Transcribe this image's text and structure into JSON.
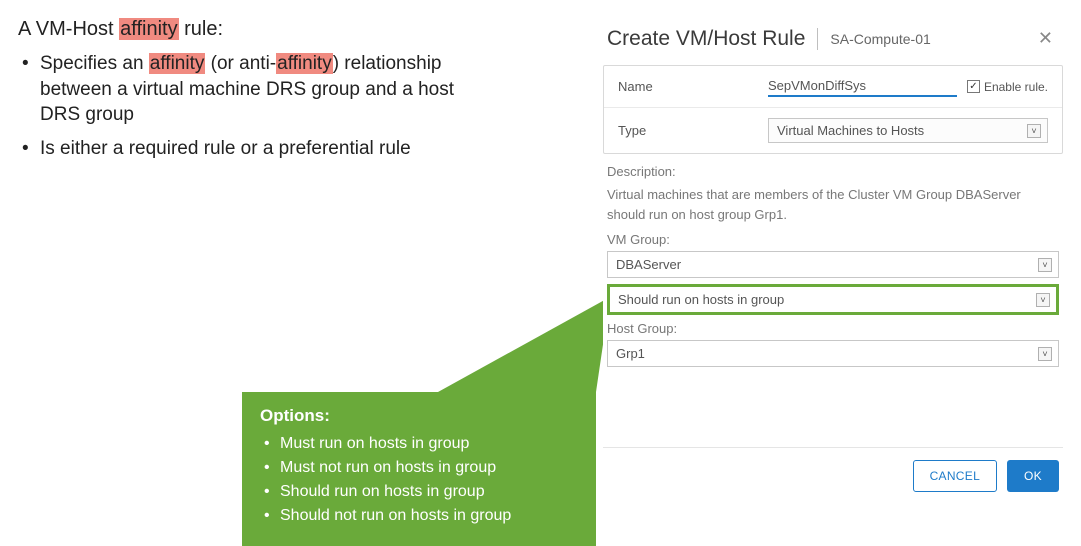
{
  "left": {
    "heading_pre": "A VM-Host ",
    "heading_hl": "affinity",
    "heading_post": " rule:",
    "bullet1_a": "Specifies an ",
    "bullet1_hl1": "affinity",
    "bullet1_b": " (or anti-",
    "bullet1_hl2": "affinity",
    "bullet1_c": ") relationship between a virtual machine DRS group and a host DRS group",
    "bullet2": "Is either a required rule or a preferential rule"
  },
  "dialog": {
    "title": "Create VM/Host Rule",
    "subtitle": "SA-Compute-01",
    "name_label": "Name",
    "name_value": "SepVMonDiffSys",
    "enable_label": "Enable rule.",
    "type_label": "Type",
    "type_value": "Virtual Machines to Hosts",
    "desc_label": "Description:",
    "desc_text": "Virtual machines that are members of the Cluster VM Group DBAServer should run on host group Grp1.",
    "vmgroup_label": "VM Group:",
    "vmgroup_value": "DBAServer",
    "rule_value": "Should run on hosts in group",
    "hostgroup_label": "Host Group:",
    "hostgroup_value": "Grp1",
    "cancel": "CANCEL",
    "ok": "OK"
  },
  "callout": {
    "title": "Options:",
    "items": [
      "Must run on hosts in group",
      "Must not run on hosts in group",
      "Should run on hosts in group",
      "Should not run on hosts in group"
    ]
  }
}
